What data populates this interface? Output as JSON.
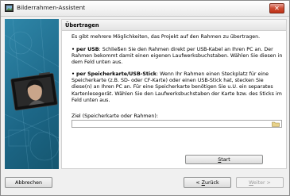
{
  "window": {
    "title": "Bilderrahmen-Assistent"
  },
  "section": {
    "title": "Übertragen"
  },
  "content": {
    "intro": "Es gibt mehrere Möglichkeiten, das Projekt auf den Rahmen zu übertragen.",
    "usb_label": "per USB",
    "usb_text": ": Schließen Sie den Rahmen direkt per USB-Kabel an Ihren PC an. Der Rahmen bekommt damit einen eigenen Laufwerksbuchstaben. Wählen Sie diesen in dem Feld unten aus.",
    "card_label": "per Speicherkarte/USB-Stick",
    "card_text": ": Wenn Ihr Rahmen einen Steckplatz für eine Speicherkarte (z.B. SD- oder CF-Karte) oder einen USB-Stick hat, stecken Sie diese(n) an Ihren PC an. Für eine Speicherkarte benötigen Sie u.U. ein separates Kartenlesegerät. Wählen Sie den Laufwerksbuchstaben der Karte bzw. des Sticks im Feld unten aus.",
    "bullet": "•"
  },
  "target": {
    "label": "Ziel (Speicherkarte oder Rahmen):",
    "value": ""
  },
  "buttons": {
    "start_underlined": "S",
    "start_rest": "tart",
    "cancel": "Abbrechen",
    "back_prefix": "< ",
    "back_underlined": "Z",
    "back_rest": "urück",
    "next_underlined": "W",
    "next_rest": "eiter >"
  },
  "icons": {
    "app": "picture-frame-icon",
    "close": "close-icon",
    "folder": "folder-icon",
    "sidebar_image": "digital-photo-frame-illustration"
  },
  "colors": {
    "sidebar": "#1c6686",
    "close": "#cc4a31"
  }
}
